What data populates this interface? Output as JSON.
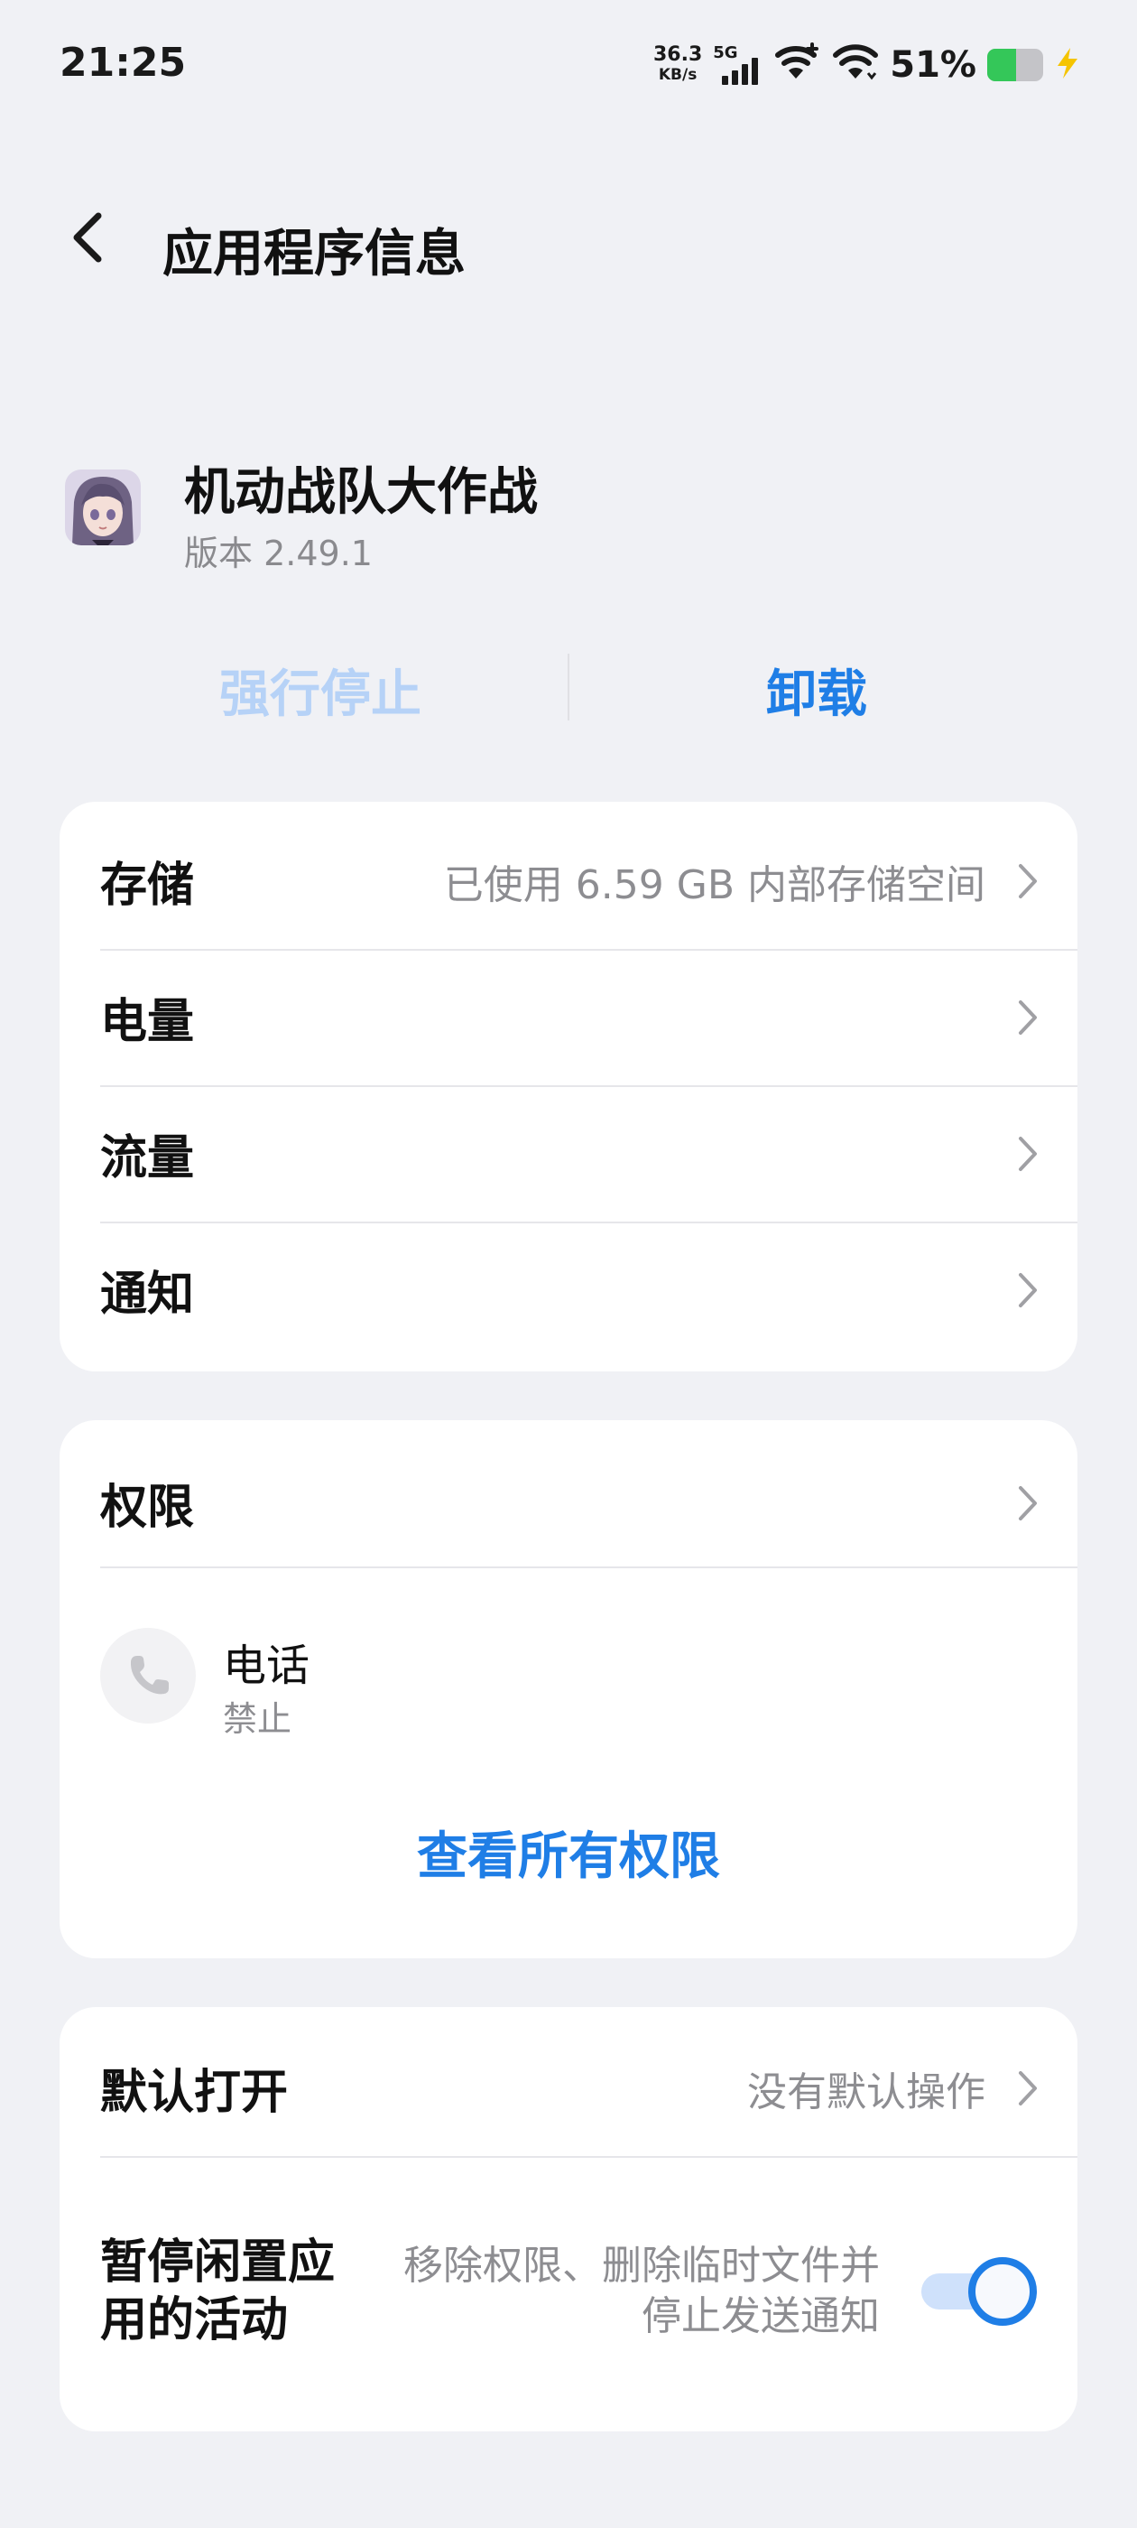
{
  "status_bar": {
    "time": "21:25",
    "net_speed_value": "36.3",
    "net_speed_unit": "KB/s",
    "network_type": "5G",
    "battery_percent": "51%",
    "battery_level": 0.51,
    "icons": [
      "signal-icon",
      "wifi-calling-icon",
      "wifi-icon",
      "battery-icon",
      "charging-icon"
    ]
  },
  "header": {
    "title": "应用程序信息",
    "back_icon": "back-arrow-icon"
  },
  "app": {
    "name": "机动战队大作战",
    "version": "版本 2.49.1"
  },
  "actions": {
    "force_stop": "强行停止",
    "uninstall": "卸载"
  },
  "info_rows": [
    {
      "label": "存储",
      "value": "已使用 6.59 GB 内部存储空间"
    },
    {
      "label": "电量",
      "value": ""
    },
    {
      "label": "流量",
      "value": ""
    },
    {
      "label": "通知",
      "value": ""
    }
  ],
  "permissions": {
    "title": "权限",
    "items": [
      {
        "name": "电话",
        "status": "禁止",
        "icon": "phone-icon"
      }
    ],
    "view_all": "查看所有权限"
  },
  "defaults": {
    "default_open_label": "默认打开",
    "default_open_value": "没有默认操作",
    "pause_label": "暂停闲置应用的活动",
    "pause_desc": "移除权限、删除临时文件并停止发送通知",
    "pause_enabled": true
  },
  "colors": {
    "accent": "#1f7ee6",
    "disabled_accent": "#b6d2f7",
    "background": "#f0f1f5",
    "card": "#ffffff",
    "secondary_text": "#8d8d91"
  }
}
